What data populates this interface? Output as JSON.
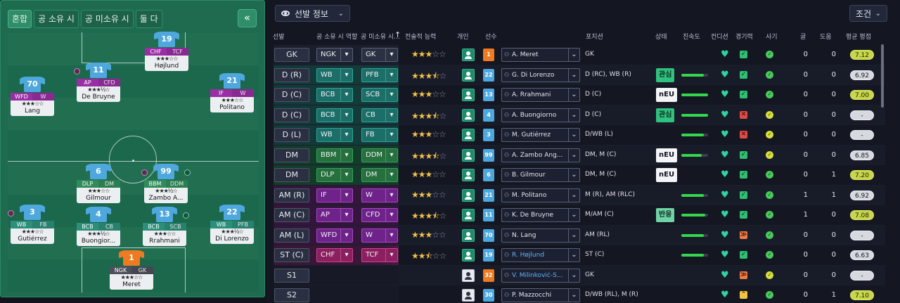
{
  "pitch": {
    "tabs": [
      "혼합",
      "공 소유 시",
      "공 미소유 시",
      "둘 다"
    ],
    "collapse_label": "«",
    "players": [
      {
        "num": "19",
        "r1": "CHF",
        "r2": "TCF",
        "stars": "★★★☆☆",
        "name": "Højlund",
        "gk": false
      },
      {
        "num": "11",
        "r1": "AP",
        "r2": "CFD",
        "stars": "★★★½☆",
        "name": "De Bruyne",
        "gk": false
      },
      {
        "num": "70",
        "r1": "WFD",
        "r2": "W",
        "stars": "★★★☆☆",
        "name": "Lang",
        "gk": false
      },
      {
        "num": "21",
        "r1": "IF",
        "r2": "W",
        "stars": "★★★☆☆",
        "name": "Politano",
        "gk": false
      },
      {
        "num": "6",
        "r1": "DLP",
        "r2": "DM",
        "stars": "★★★☆☆",
        "name": "Gilmour",
        "gk": false
      },
      {
        "num": "99",
        "r1": "BBM",
        "r2": "DDM",
        "stars": "★★★½☆",
        "name": "Zambo A...",
        "gk": false
      },
      {
        "num": "3",
        "r1": "WB",
        "r2": "FB",
        "stars": "★★★☆☆",
        "name": "Gutiérrez",
        "gk": false
      },
      {
        "num": "4",
        "r1": "BCB",
        "r2": "CB",
        "stars": "★★★½☆",
        "name": "Buongior...",
        "gk": false
      },
      {
        "num": "13",
        "r1": "BCB",
        "r2": "SCB",
        "stars": "★★★☆☆",
        "name": "Rrahmani",
        "gk": false
      },
      {
        "num": "22",
        "r1": "WB",
        "r2": "PFB",
        "stars": "★★★½☆",
        "name": "Di Lorenzo",
        "gk": false
      },
      {
        "num": "1",
        "r1": "NGK",
        "r2": "GK",
        "stars": "★★★☆☆",
        "name": "Meret",
        "gk": true
      }
    ]
  },
  "toolbar": {
    "view_label": "선발 정보",
    "condition_label": "조건"
  },
  "columns": {
    "slot": "선발",
    "ip_role": "공 소유 시 역할",
    "oop_role": "공 미소유 시...",
    "sort_arrow": "↑",
    "tactical": "전술적 능력",
    "individual": "개인",
    "player": "선수",
    "position": "포지션",
    "status": "상태",
    "familiarity": "친숙도",
    "condition": "컨디션",
    "match_sharpness": "경기력",
    "morale": "사기",
    "goals": "골",
    "assists": "도움",
    "avg_rating": "평균 평점"
  },
  "rows": [
    {
      "slot": "GK",
      "ip": "NGK",
      "oop": "GK",
      "cls": "gk",
      "stars": 3,
      "half": false,
      "indiv": true,
      "num": "1",
      "gk": true,
      "player": "A. Meret",
      "link": false,
      "pos": "GK",
      "tag": "",
      "tagc": "",
      "fam": 0,
      "cond": "ok",
      "mor": "g",
      "goals": "0",
      "assists": "0",
      "rating": "7.12",
      "rc": "lime"
    },
    {
      "slot": "D (R)",
      "ip": "WB",
      "oop": "PFB",
      "cls": "def",
      "stars": 3,
      "half": true,
      "indiv": true,
      "num": "22",
      "gk": false,
      "player": "G. Di Lorenzo",
      "link": false,
      "pos": "D (RC), WB (R)",
      "tag": "관심",
      "tagc": "green",
      "fam": 0.85,
      "cond": "ok",
      "mor": "g",
      "goals": "0",
      "assists": "0",
      "rating": "6.92",
      "rc": "grey"
    },
    {
      "slot": "D (C)",
      "ip": "BCB",
      "oop": "SCB",
      "cls": "def",
      "stars": 3,
      "half": false,
      "indiv": true,
      "num": "13",
      "gk": false,
      "player": "A. Rrahmani",
      "link": false,
      "pos": "D (C)",
      "tag": "nEU",
      "tagc": "white",
      "fam": 1.0,
      "cond": "ok",
      "mor": "g",
      "goals": "0",
      "assists": "0",
      "rating": "7.00",
      "rc": "lime"
    },
    {
      "slot": "D (C)",
      "ip": "BCB",
      "oop": "CB",
      "cls": "def",
      "stars": 3,
      "half": true,
      "indiv": true,
      "num": "4",
      "gk": false,
      "player": "A. Buongiorno",
      "link": false,
      "pos": "D (C)",
      "tag": "관심",
      "tagc": "green",
      "fam": 1.0,
      "cond": "no",
      "mor": "y",
      "goals": "0",
      "assists": "0",
      "rating": "-",
      "rc": "grey"
    },
    {
      "slot": "D (L)",
      "ip": "WB",
      "oop": "FB",
      "cls": "def",
      "stars": 3,
      "half": false,
      "indiv": true,
      "num": "3",
      "gk": false,
      "player": "M. Gutiérrez",
      "link": false,
      "pos": "D/WB (L)",
      "tag": "",
      "tagc": "",
      "fam": 0.85,
      "cond": "no",
      "mor": "y",
      "goals": "0",
      "assists": "0",
      "rating": "-",
      "rc": "grey"
    },
    {
      "slot": "DM",
      "ip": "BBM",
      "oop": "DDM",
      "cls": "mid",
      "stars": 3,
      "half": true,
      "indiv": true,
      "num": "99",
      "gk": false,
      "player": "A. Zambo Ang...",
      "link": false,
      "pos": "DM, M (C)",
      "tag": "nEU",
      "tagc": "white",
      "fam": 0.75,
      "cond": "ok",
      "mor": "y",
      "goals": "0",
      "assists": "0",
      "rating": "6.85",
      "rc": "grey"
    },
    {
      "slot": "DM",
      "ip": "DLP",
      "oop": "DM",
      "cls": "mid",
      "stars": 3,
      "half": false,
      "indiv": true,
      "num": "6",
      "gk": false,
      "player": "B. Gilmour",
      "link": false,
      "pos": "DM, M (C)",
      "tag": "nEU",
      "tagc": "white",
      "fam": 0.0,
      "cond": "ok",
      "mor": "g",
      "goals": "0",
      "assists": "1",
      "rating": "7.20",
      "rc": "lime"
    },
    {
      "slot": "AM (R)",
      "ip": "IF",
      "oop": "W",
      "cls": "att",
      "stars": 3,
      "half": false,
      "indiv": true,
      "num": "21",
      "gk": false,
      "player": "M. Politano",
      "link": false,
      "pos": "M (R), AM (RLC)",
      "tag": "",
      "tagc": "",
      "fam": 0.85,
      "cond": "ok",
      "mor": "g",
      "goals": "1",
      "assists": "1",
      "rating": "6.92",
      "rc": "grey"
    },
    {
      "slot": "AM (C)",
      "ip": "AP",
      "oop": "CFD",
      "cls": "att",
      "stars": 3,
      "half": true,
      "indiv": true,
      "num": "11",
      "gk": false,
      "player": "K. De Bruyne",
      "link": false,
      "pos": "M/AM (C)",
      "tag": "반응",
      "tagc": "teal",
      "fam": 0.9,
      "cond": "ok",
      "mor": "g",
      "goals": "1",
      "assists": "0",
      "rating": "7.08",
      "rc": "lime"
    },
    {
      "slot": "AM (L)",
      "ip": "WFD",
      "oop": "W",
      "cls": "att",
      "stars": 3,
      "half": false,
      "indiv": true,
      "num": "70",
      "gk": false,
      "player": "N. Lang",
      "link": false,
      "pos": "AM (RL)",
      "tag": "",
      "tagc": "",
      "fam": 0.85,
      "cond": "warn",
      "mor": "g",
      "goals": "0",
      "assists": "0",
      "rating": "-",
      "rc": "grey"
    },
    {
      "slot": "ST (C)",
      "ip": "CHF",
      "oop": "TCF",
      "cls": "st",
      "stars": 2,
      "half": true,
      "indiv": true,
      "num": "19",
      "gk": false,
      "player": "R. Højlund",
      "link": true,
      "pos": "ST (C)",
      "tag": "",
      "tagc": "",
      "fam": 0.85,
      "cond": "ok",
      "mor": "g",
      "goals": "0",
      "assists": "0",
      "rating": "6.63",
      "rc": "grey"
    },
    {
      "slot": "S1",
      "ip": "",
      "oop": "",
      "cls": "sub",
      "stars": 0,
      "half": false,
      "indiv": false,
      "num": "32",
      "gk": true,
      "player": "V. Milinković-S...",
      "link": true,
      "pos": "GK",
      "tag": "",
      "tagc": "",
      "fam": 0,
      "cond": "warn",
      "mor": "y",
      "goals": "0",
      "assists": "0",
      "rating": "-",
      "rc": "grey"
    },
    {
      "slot": "S2",
      "ip": "",
      "oop": "",
      "cls": "sub",
      "stars": 0,
      "half": false,
      "indiv": false,
      "num": "30",
      "gk": false,
      "player": "P. Mazzocchi",
      "link": false,
      "pos": "D/WB (RL), M (R)",
      "tag": "",
      "tagc": "",
      "fam": 0,
      "cond": "up",
      "mor": "g",
      "goals": "0",
      "assists": "1",
      "rating": "7.10",
      "rc": "lime"
    }
  ],
  "colors": {
    "accent": "#2f8d68",
    "condition": "#35d64d",
    "rating_high": "#c7d64a"
  }
}
